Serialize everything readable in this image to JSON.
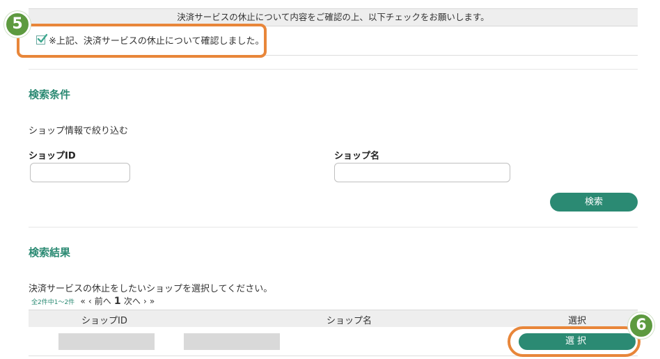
{
  "notice": {
    "text": "決済サービスの休止について内容をご確認の上、以下チェックをお願いします。",
    "checkbox_label": "※上記、決済サービスの休止について確認しました。",
    "checked": true
  },
  "steps": {
    "step5": "5",
    "step6": "6"
  },
  "search": {
    "title": "検索条件",
    "filter_caption": "ショップ情報で絞り込む",
    "shop_id_label": "ショップID",
    "shop_name_label": "ショップ名",
    "shop_id_value": "",
    "shop_name_value": "",
    "search_button": "検索"
  },
  "results": {
    "title": "検索結果",
    "instruction": "決済サービスの休止をしたいショップを選択してください。",
    "pager": {
      "count": "全2件中1～2件",
      "first": "«",
      "prev_arrow": "‹",
      "prev": "前へ",
      "current": "1",
      "next": "次へ",
      "next_arrow": "›",
      "last": "»"
    },
    "columns": [
      "ショップID",
      "ショップ名",
      "選択"
    ],
    "select_button": "選択"
  },
  "colors": {
    "accent": "#2b8a73",
    "highlight": "#e8863a",
    "badge": "#5d9a3f"
  },
  "icons": {
    "checkbox": "checkbox-checked-icon"
  }
}
